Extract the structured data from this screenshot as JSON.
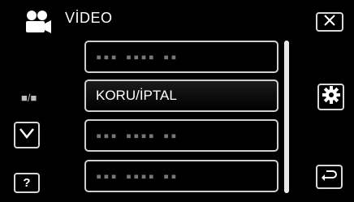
{
  "header": {
    "title": "VİDEO",
    "mode_icon": "video-camera-icon"
  },
  "controls": {
    "close_icon": "close-icon",
    "settings_icon": "gear-icon",
    "back_icon": "return-icon",
    "down_icon": "chevron-down-icon",
    "help_label": "?",
    "page_indicator": "■/■"
  },
  "menu": {
    "items": [
      {
        "label": "▪▪▪ ▪▪▪▪ ▪▪",
        "state": "unavailable"
      },
      {
        "label": "KORU/İPTAL",
        "state": "available"
      },
      {
        "label": "▪▪▪ ▪▪▪▪ ▪▪",
        "state": "unavailable"
      },
      {
        "label": "▪▪▪ ▪▪▪▪ ▪▪",
        "state": "unavailable"
      }
    ]
  },
  "colors": {
    "background": "#000000",
    "border": "#d8d8d8",
    "text": "#ffffff",
    "dim_text": "#777777"
  }
}
